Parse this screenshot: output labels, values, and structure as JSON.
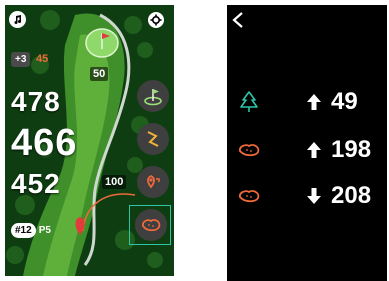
{
  "left_screen": {
    "score_to_par": "+3",
    "strokes": "45",
    "distances": {
      "back": "478",
      "middle": "466",
      "front": "452"
    },
    "map_labels": {
      "green_marker": "50",
      "layup_marker": "100"
    },
    "hole": {
      "number": "#12",
      "par": "P5"
    },
    "colors": {
      "accent_orange": "#ef6a3a",
      "highlight": "#2ec4a8"
    }
  },
  "right_screen": {
    "hazards": [
      {
        "icon": "tree-icon",
        "direction": "up",
        "value": "49",
        "color": "#2ec4a8"
      },
      {
        "icon": "bunker-icon",
        "direction": "up",
        "value": "198",
        "color": "#ef6a3a"
      },
      {
        "icon": "bunker-icon",
        "direction": "down",
        "value": "208",
        "color": "#ef6a3a"
      }
    ]
  }
}
